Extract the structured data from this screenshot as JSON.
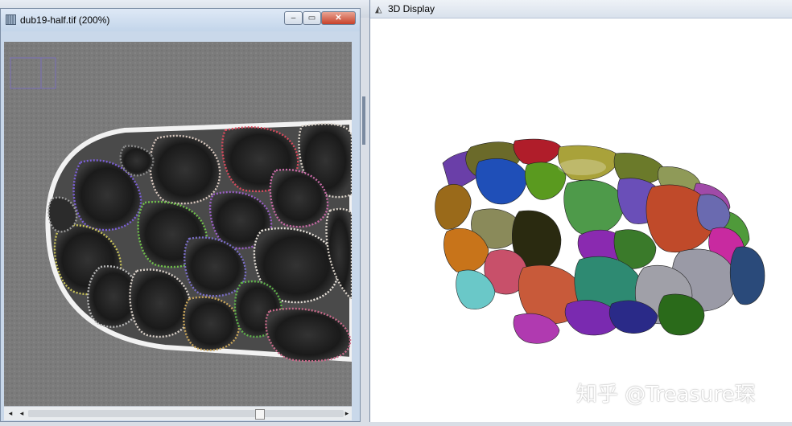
{
  "left_window": {
    "title": "dub19-half.tif (200%)",
    "minimize_label": "–",
    "maximize_label": "▭",
    "close_label": "✕",
    "scroll_left": "◂",
    "scroll_right": "▸"
  },
  "right_window": {
    "title": "3D Display"
  },
  "watermark": "知乎 @Treasure琛",
  "colors": {
    "titlebar": "#c8d9ee",
    "close": "#c7412a",
    "canvas_bg": "#ffffff"
  }
}
